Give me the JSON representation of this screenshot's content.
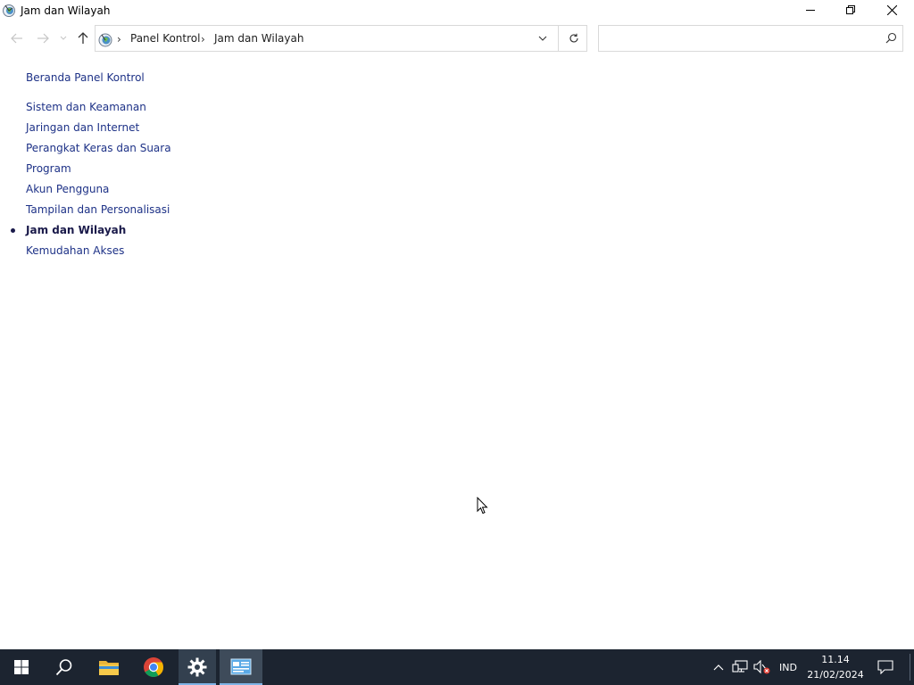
{
  "window": {
    "title": "Jam dan Wilayah",
    "controls": {
      "minimize": "minimize",
      "maximize": "maximize",
      "close": "close"
    }
  },
  "address_bar": {
    "breadcrumbs": [
      "Panel Kontrol",
      "Jam dan Wilayah"
    ],
    "search_placeholder": ""
  },
  "left_nav": {
    "home": "Beranda Panel Kontrol",
    "categories": [
      "Sistem dan Keamanan",
      "Jaringan dan Internet",
      "Perangkat Keras dan Suara",
      "Program",
      "Akun Pengguna",
      "Tampilan dan Personalisasi",
      "Jam dan Wilayah",
      "Kemudahan Akses"
    ],
    "current": "Jam dan Wilayah"
  },
  "taskbar": {
    "apps": [
      "windows-start-icon",
      "search-icon",
      "file-explorer-icon",
      "chrome-icon",
      "settings-icon",
      "control-panel-icon"
    ],
    "tray": {
      "language": "IND",
      "time": "11.14",
      "date": "21/02/2024"
    }
  },
  "colors": {
    "link": "#1e3287",
    "taskbar_bg": "#1c2430",
    "active_underline": "#7eb3e6"
  }
}
